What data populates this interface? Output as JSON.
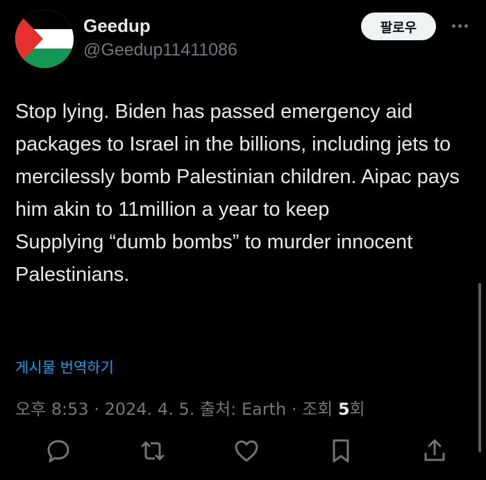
{
  "author": {
    "display_name": "Geedup",
    "handle": "@Geedup11411086"
  },
  "avatar": {
    "icon": "palestine-flag",
    "colors": {
      "black": "#000000",
      "white": "#ffffff",
      "green": "#149954",
      "red": "#e4312b"
    }
  },
  "follow_label": "팔로우",
  "tweet": {
    "text": "Stop lying. Biden has passed emergency aid packages to Israel in the billions, including jets to mercilessly bomb Palestinian children. Aipac pays him akin to 11million a year to keep\nSupplying “dumb bombs” to murder innocent Palestinians."
  },
  "translate_label": "게시물 번역하기",
  "meta": {
    "time": "오후 8:53",
    "date": "2024. 4. 5.",
    "source": "출처: Earth",
    "views_prefix": "조회 ",
    "views_count": "5",
    "views_suffix": "회"
  },
  "actions": [
    "reply-icon",
    "retweet-icon",
    "like-icon",
    "bookmark-icon",
    "share-icon"
  ],
  "theme": {
    "background": "#000000",
    "text": "#e7e9ea",
    "muted": "#71767b",
    "link": "#1d9bf0"
  }
}
